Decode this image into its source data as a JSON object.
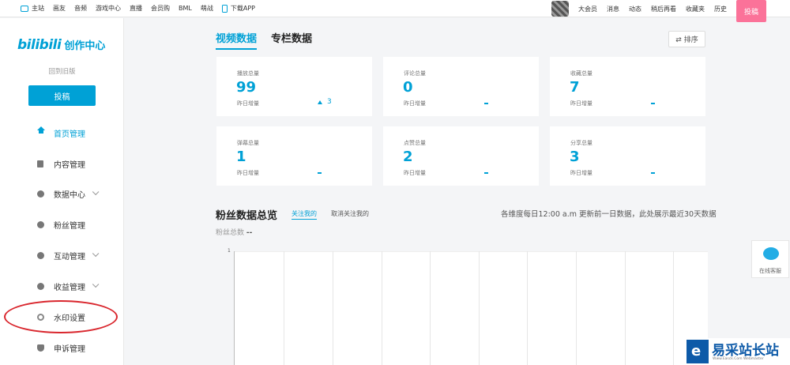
{
  "topbar": {
    "left_items": [
      "主站",
      "画友",
      "音频",
      "游戏中心",
      "直播",
      "会员购",
      "BML",
      "萌战"
    ],
    "download_app": "下载APP",
    "right_items": [
      "大会员",
      "消息",
      "动态",
      "稍后再看",
      "收藏夹",
      "历史"
    ],
    "upload": "投稿"
  },
  "sidebar": {
    "logo_brand": "bilibili",
    "logo_title": "创作中心",
    "back_old": "回到旧版",
    "upload": "投稿",
    "items": [
      {
        "label": "首页管理",
        "icon": "home-icon"
      },
      {
        "label": "内容管理",
        "icon": "document-icon"
      },
      {
        "label": "数据中心",
        "icon": "data-icon"
      },
      {
        "label": "粉丝管理",
        "icon": "fans-icon"
      },
      {
        "label": "互动管理",
        "icon": "chat-icon"
      },
      {
        "label": "收益管理",
        "icon": "money-icon"
      },
      {
        "label": "水印设置",
        "icon": "gear-icon"
      },
      {
        "label": "申诉管理",
        "icon": "shield-icon"
      }
    ]
  },
  "main": {
    "tabs": [
      "视频数据",
      "专栏数据"
    ],
    "sort": "⇄ 排序",
    "cards": [
      {
        "title": "播放总量",
        "value": "99",
        "yesterday_label": "昨日增量",
        "delta": "3"
      },
      {
        "title": "评论总量",
        "value": "0",
        "yesterday_label": "昨日增量",
        "delta": "-"
      },
      {
        "title": "收藏总量",
        "value": "7",
        "yesterday_label": "昨日增量",
        "delta": "-"
      },
      {
        "title": "弹幕总量",
        "value": "1",
        "yesterday_label": "昨日增量",
        "delta": "-"
      },
      {
        "title": "点赞总量",
        "value": "2",
        "yesterday_label": "昨日增量",
        "delta": "-"
      },
      {
        "title": "分享总量",
        "value": "3",
        "yesterday_label": "昨日增量",
        "delta": "-"
      }
    ],
    "fans": {
      "title": "粉丝数据总览",
      "tab_follow": "关注我的",
      "tab_unfollow": "取消关注我的",
      "note": "各维度每日12:00 a.m 更新前一日数据，此处展示最近30天数据",
      "total_label": "粉丝总数",
      "total_value": "--"
    }
  },
  "chart_data": {
    "type": "line",
    "y_tick": "1",
    "series": []
  },
  "customer_service": "在线客服",
  "watermark": {
    "logo_letter": "e",
    "text": "易采站长站",
    "sub": "Www.Easck.Com  Webmaster"
  },
  "colors": {
    "accent": "#00a1d6",
    "pink": "#fb7299",
    "highlight": "#d9262d"
  }
}
